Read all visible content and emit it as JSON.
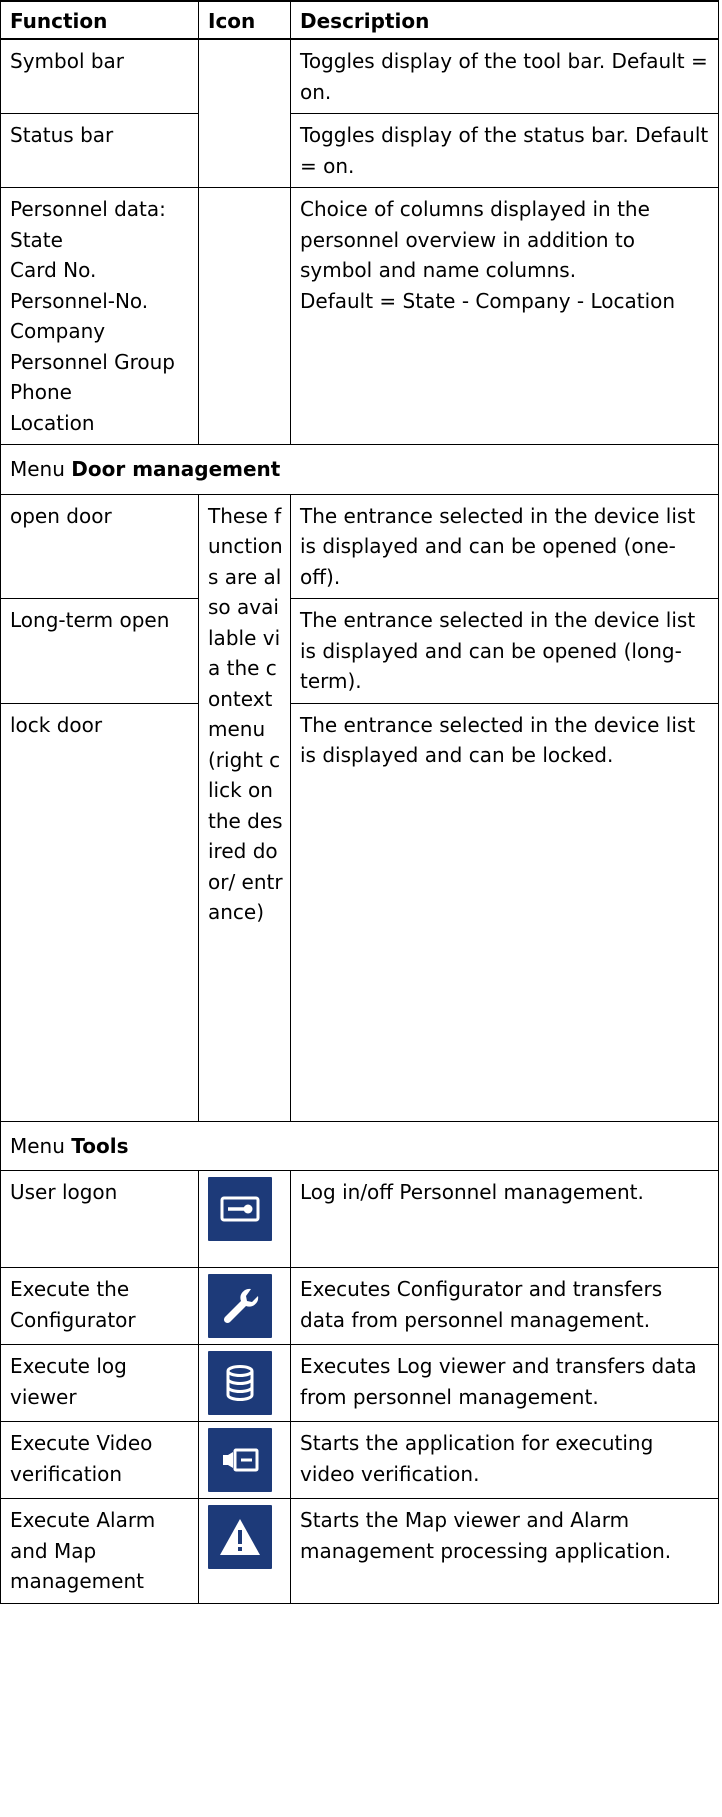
{
  "header": {
    "function": "Function",
    "icon": "Icon",
    "description": "Description"
  },
  "rows_view": [
    {
      "function": "Symbol bar",
      "description": "Toggles display of the tool bar. Default = on."
    },
    {
      "function": "Status bar",
      "description": "Toggles display of the status bar. Default = on."
    },
    {
      "function": "Personnel data:\nState\nCard No.\nPersonnel-No.\nCompany\nPersonnel Group\nPhone\nLocation",
      "description": "Choice of columns displayed in the personnel overview in addition to symbol and name columns.\nDefault = State - Company - Location"
    }
  ],
  "section_door": {
    "prefix": "Menu ",
    "name": "Door management"
  },
  "rows_door": [
    {
      "function": "open door",
      "description": "The entrance selected in the device list is displayed and can be opened (one-off)."
    },
    {
      "function": "Long-term open",
      "description": "The entrance selected in the device list is displayed and can be opened (long-term)."
    },
    {
      "function": "lock door",
      "description": "The entrance selected in the device list is displayed and can be locked."
    }
  ],
  "door_icon_note": "These functions are also available via the context menu (right click on the desired door/ entrance)",
  "section_tools": {
    "prefix": "Menu ",
    "name": "Tools"
  },
  "rows_tools": [
    {
      "function": "User logon",
      "icon": "key-card-icon",
      "description": "Log in/off Personnel management."
    },
    {
      "function": "Execute the Configurator",
      "icon": "wrench-icon",
      "description": "Executes Configurator and transfers data from personnel management."
    },
    {
      "function": "Execute log viewer",
      "icon": "database-icon",
      "description": "Executes Log viewer and transfers data from personnel management."
    },
    {
      "function": "Execute Video verification",
      "icon": "video-camera-icon",
      "description": "Starts the application for executing video verification."
    },
    {
      "function": "Execute Alarm and Map management",
      "icon": "warning-icon",
      "description": "Starts the Map viewer and Alarm management processing application."
    }
  ],
  "colors": {
    "icon_bg": "#1d3a79",
    "icon_fg": "#ffffff"
  }
}
